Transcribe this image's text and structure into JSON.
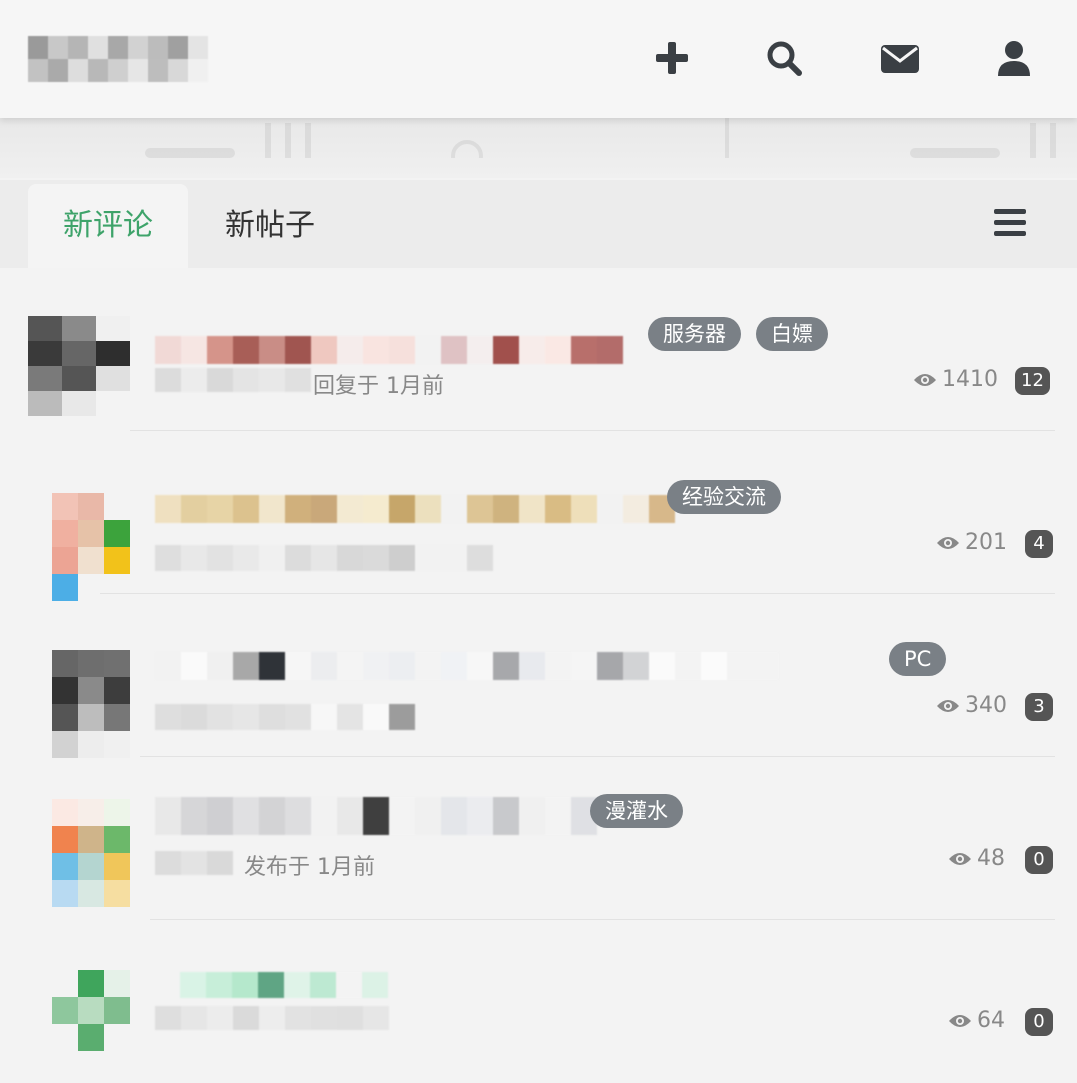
{
  "header": {
    "logo_alt": "",
    "icons": [
      "plus-icon",
      "search-icon",
      "envelope-icon",
      "user-icon"
    ]
  },
  "tabs": [
    {
      "label": "新评论",
      "active": true
    },
    {
      "label": "新帖子",
      "active": false
    }
  ],
  "menu_icon": "bars-icon",
  "colors": {
    "accent": "#3ea36a",
    "tag_bg": "#7a8086",
    "count_bg": "#555555",
    "icon": "#3a3f44"
  },
  "posts": [
    {
      "tags": [
        "服务器",
        "白嫖"
      ],
      "meta": "回复于 1月前",
      "views": "1410",
      "count": "12"
    },
    {
      "tags": [
        "经验交流"
      ],
      "meta": "",
      "views": "201",
      "count": "4"
    },
    {
      "tags": [
        "PC"
      ],
      "meta": "",
      "views": "340",
      "count": "3"
    },
    {
      "tags": [
        "漫灌水"
      ],
      "meta": "发布于 1月前",
      "views": "48",
      "count": "0"
    },
    {
      "tags": [],
      "meta": "",
      "views": "64",
      "count": "0"
    }
  ]
}
